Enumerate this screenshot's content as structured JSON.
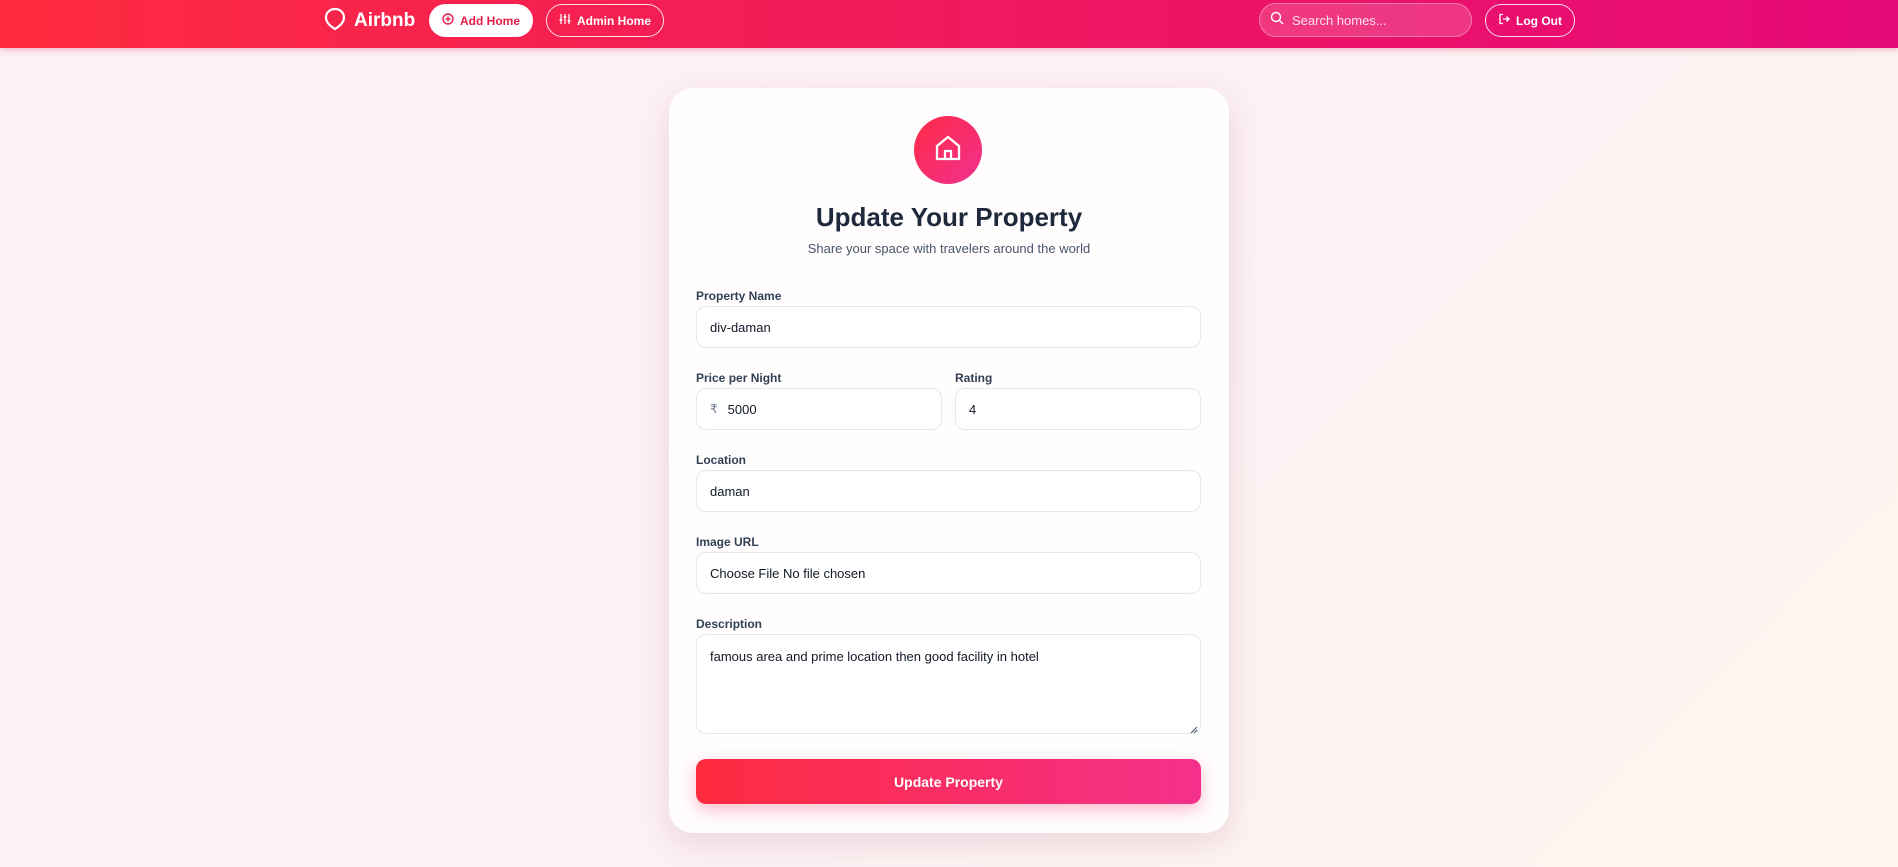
{
  "navbar": {
    "brand": "Airbnb",
    "add_home_label": "Add Home",
    "admin_home_label": "Admin Home",
    "search_placeholder": "Search homes...",
    "logout_label": "Log Out"
  },
  "form": {
    "title": "Update Your Property",
    "subtitle": "Share your space with travelers around the world",
    "property_name": {
      "label": "Property Name",
      "value": "div-daman"
    },
    "price": {
      "label": "Price per Night",
      "currency": "₹",
      "value": "5000"
    },
    "rating": {
      "label": "Rating",
      "value": "4"
    },
    "location": {
      "label": "Location",
      "value": "daman"
    },
    "image": {
      "label": "Image URL",
      "value": "Choose File No file chosen"
    },
    "description": {
      "label": "Description",
      "value": "famous area and prime location then good facility in hotel"
    },
    "submit_label": "Update Property"
  },
  "colors": {
    "accent": "#e11d48",
    "gradient_start": "#fe2b3f",
    "gradient_end": "#e6097a"
  }
}
